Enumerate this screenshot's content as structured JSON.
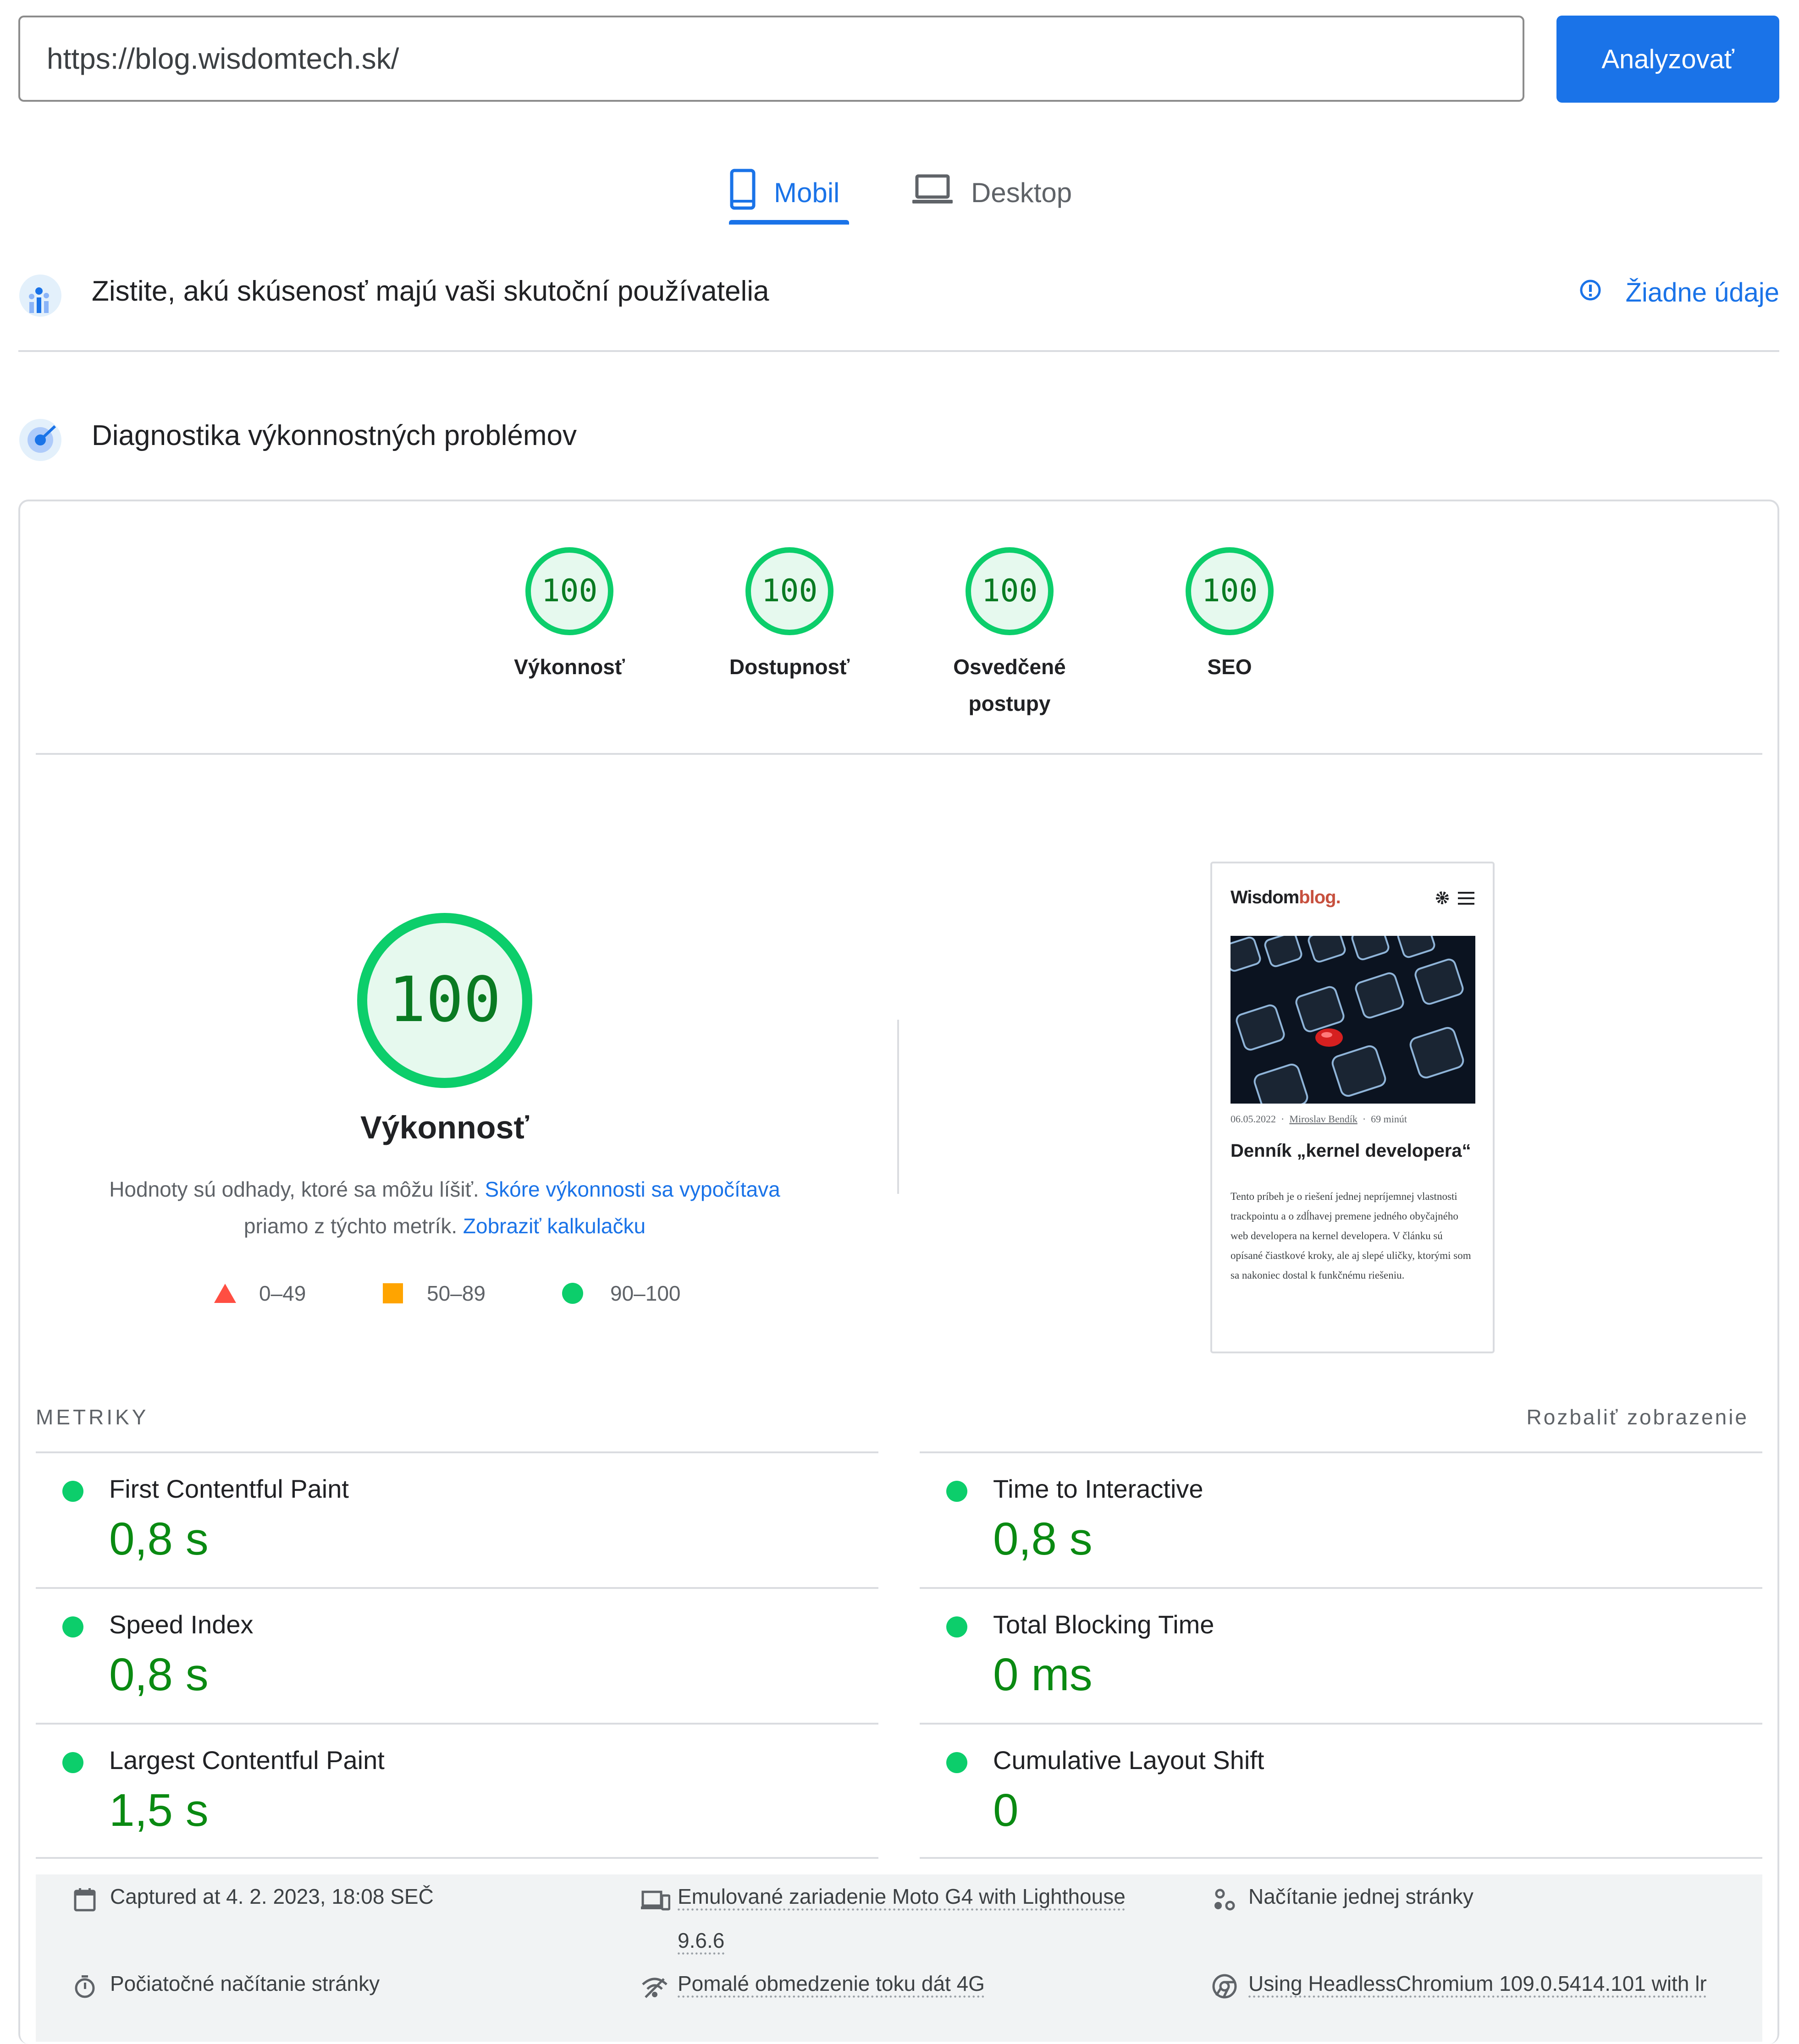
{
  "url_bar": {
    "value": "https://blog.wisdomtech.sk/",
    "analyze_label": "Analyzovať"
  },
  "tabs": [
    {
      "label": "Mobil",
      "active": true
    },
    {
      "label": "Desktop",
      "active": false
    }
  ],
  "field_data": {
    "title": "Zistite, akú skúsenosť majú vaši skutoční používatelia",
    "no_data_label": "Žiadne údaje"
  },
  "diagnostics": {
    "title": "Diagnostika výkonnostných problémov"
  },
  "categories": [
    {
      "score": "100",
      "label": "Výkonnosť"
    },
    {
      "score": "100",
      "label": "Dostupnosť"
    },
    {
      "score": "100",
      "label": "Osvedčené postupy"
    },
    {
      "score": "100",
      "label": "SEO"
    }
  ],
  "performance": {
    "score": "100",
    "title": "Výkonnosť",
    "desc_text_1": "Hodnoty sú odhady, ktoré sa môžu líšiť.",
    "desc_link_1": "Skóre výkonnosti sa vypočítava",
    "desc_text_2": "priamo z týchto metrík.",
    "desc_link_2": "Zobraziť kalkulačku",
    "legend": [
      {
        "range": "0–49"
      },
      {
        "range": "50–89"
      },
      {
        "range": "90–100"
      }
    ]
  },
  "screenshot": {
    "logo_main": "Wisdom",
    "logo_accent": "blog.",
    "date": "06.05.2022",
    "author": "Miroslav Bendík",
    "read_time": "69 minút",
    "headline": "Denník „kernel developera“",
    "excerpt": "Tento príbeh je o riešení jednej nepríjemnej vlastnosti trackpointu a o zdĺhavej premene jedného obyčajného web developera na kernel developera. V článku sú opísané čiastkové kroky, ale aj slepé uličky, ktorými som sa nakoniec dostal k funkčnému riešeniu."
  },
  "metrics_header": {
    "label": "METRIKY",
    "expand_label": "Rozbaliť zobrazenie"
  },
  "metrics": [
    {
      "name": "First Contentful Paint",
      "value": "0,8 s"
    },
    {
      "name": "Time to Interactive",
      "value": "0,8 s"
    },
    {
      "name": "Speed Index",
      "value": "0,8 s"
    },
    {
      "name": "Total Blocking Time",
      "value": "0 ms"
    },
    {
      "name": "Largest Contentful Paint",
      "value": "1,5 s"
    },
    {
      "name": "Cumulative Layout Shift",
      "value": "0"
    }
  ],
  "footer": {
    "captured": "Captured at 4. 2. 2023, 18:08 SEČ",
    "device": "Emulované zariadenie Moto G4 with Lighthouse",
    "device_version": "9.6.6",
    "load": "Načítanie jednej stránky",
    "initial": "Počiatočné načítanie stránky",
    "throttle": "Pomalé obmedzenie toku dát 4G",
    "browser": "Using HeadlessChromium 109.0.5414.101 with lr"
  },
  "colors": {
    "accent": "#1a73e8",
    "pass": "#0cce6b",
    "pass_text": "#0a8a12",
    "average": "#ffa400",
    "fail": "#ff4e42"
  }
}
